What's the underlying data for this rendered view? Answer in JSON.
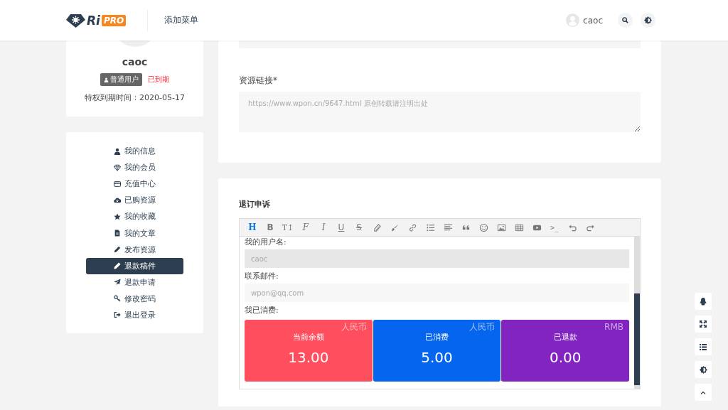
{
  "header": {
    "logo": {
      "text": "Ri",
      "badge": "PRO"
    },
    "menu": "添加菜单",
    "user": "caoc"
  },
  "profile": {
    "name": "caoc",
    "role": "普通用户",
    "status": "已到期",
    "expiry": "特权到期时间：2020-05-17"
  },
  "menu": [
    {
      "label": "我的信息",
      "selected": false
    },
    {
      "label": "我的会员",
      "selected": false
    },
    {
      "label": "充值中心",
      "selected": false
    },
    {
      "label": "已购资源",
      "selected": false
    },
    {
      "label": "我的收藏",
      "selected": false
    },
    {
      "label": "我的文章",
      "selected": false
    },
    {
      "label": "发布资源",
      "selected": false
    },
    {
      "label": "退款稿件",
      "selected": true
    },
    {
      "label": "退款申请",
      "selected": false
    },
    {
      "label": "修改密码",
      "selected": false
    },
    {
      "label": "退出登录",
      "selected": false
    }
  ],
  "resource_link": {
    "label": "资源链接*",
    "placeholder": "https://www.wpon.cn/9647.html 原创转载请注明出处"
  },
  "refund": {
    "title": "退订申诉",
    "toolbar": [
      {
        "label": "H",
        "selected": true
      },
      {
        "label": "B",
        "selected": false
      },
      {
        "label": "T↕",
        "selected": false
      },
      {
        "label": "F",
        "selected": false
      },
      {
        "label": "I",
        "selected": false
      },
      {
        "label": "U",
        "selected": false
      },
      {
        "label": "S",
        "selected": false
      },
      {
        "selected": false
      },
      {
        "selected": false
      },
      {
        "selected": false
      },
      {
        "selected": false
      },
      {
        "selected": false
      },
      {
        "selected": false
      },
      {
        "selected": false
      },
      {
        "selected": false
      },
      {
        "selected": false
      },
      {
        "selected": false
      },
      {
        "label": ">_",
        "selected": false
      },
      {
        "selected": false
      },
      {
        "selected": false
      }
    ],
    "fields": [
      {
        "label": "我的用户名:",
        "placeholder": "caoc",
        "readonly": true
      },
      {
        "label": "联系邮件:",
        "placeholder": "wpon@qq.com",
        "readonly": false
      }
    ],
    "spent_label": "我已消费:",
    "stats": [
      {
        "currency": "人民币",
        "label": "当前余额",
        "value": "13.00",
        "color": "#ff4f5e"
      },
      {
        "currency": "人民币",
        "label": "已消费",
        "value": "5.00",
        "color": "#0665ef"
      },
      {
        "currency": "RMB",
        "label": "已退款",
        "value": "0.00",
        "color": "#8224c0"
      }
    ]
  }
}
